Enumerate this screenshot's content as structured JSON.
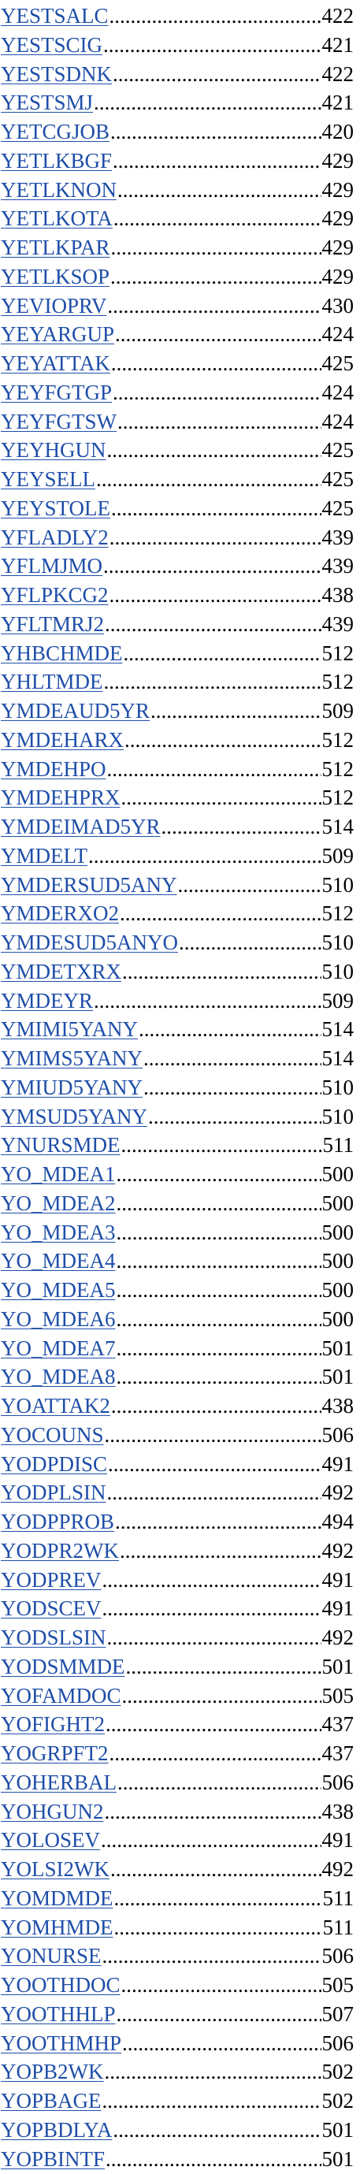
{
  "entries": [
    {
      "name": "YESTSALC",
      "page": "422"
    },
    {
      "name": "YESTSCIG",
      "page": "421"
    },
    {
      "name": "YESTSDNK",
      "page": "422"
    },
    {
      "name": "YESTSMJ",
      "page": "421"
    },
    {
      "name": "YETCGJOB",
      "page": "420"
    },
    {
      "name": "YETLKBGF",
      "page": "429"
    },
    {
      "name": "YETLKNON",
      "page": "429"
    },
    {
      "name": "YETLKOTA",
      "page": "429"
    },
    {
      "name": "YETLKPAR",
      "page": "429"
    },
    {
      "name": "YETLKSOP",
      "page": "429"
    },
    {
      "name": "YEVIOPRV",
      "page": "430"
    },
    {
      "name": "YEYARGUP",
      "page": "424"
    },
    {
      "name": "YEYATTAK",
      "page": "425"
    },
    {
      "name": "YEYFGTGP",
      "page": "424"
    },
    {
      "name": "YEYFGTSW",
      "page": "424"
    },
    {
      "name": "YEYHGUN",
      "page": "425"
    },
    {
      "name": "YEYSELL",
      "page": "425"
    },
    {
      "name": "YEYSTOLE",
      "page": "425"
    },
    {
      "name": "YFLADLY2",
      "page": "439"
    },
    {
      "name": "YFLMJMO",
      "page": "439"
    },
    {
      "name": "YFLPKCG2",
      "page": "438"
    },
    {
      "name": "YFLTMRJ2",
      "page": "439"
    },
    {
      "name": "YHBCHMDE",
      "page": "512"
    },
    {
      "name": "YHLTMDE",
      "page": "512"
    },
    {
      "name": "YMDEAUD5YR",
      "page": "509"
    },
    {
      "name": "YMDEHARX",
      "page": "512"
    },
    {
      "name": "YMDEHPO",
      "page": "512"
    },
    {
      "name": "YMDEHPRX",
      "page": "512"
    },
    {
      "name": "YMDEIMAD5YR",
      "page": "514"
    },
    {
      "name": "YMDELT",
      "page": "509"
    },
    {
      "name": "YMDERSUD5ANY",
      "page": "510"
    },
    {
      "name": "YMDERXO2",
      "page": "512"
    },
    {
      "name": "YMDESUD5ANYO",
      "page": "510"
    },
    {
      "name": "YMDETXRX",
      "page": "510"
    },
    {
      "name": "YMDEYR",
      "page": "509"
    },
    {
      "name": "YMIMI5YANY",
      "page": "514"
    },
    {
      "name": "YMIMS5YANY",
      "page": "514"
    },
    {
      "name": "YMIUD5YANY",
      "page": "510"
    },
    {
      "name": "YMSUD5YANY",
      "page": "510"
    },
    {
      "name": "YNURSMDE",
      "page": "511"
    },
    {
      "name": "YO_MDEA1",
      "page": "500"
    },
    {
      "name": "YO_MDEA2",
      "page": "500"
    },
    {
      "name": "YO_MDEA3",
      "page": "500"
    },
    {
      "name": "YO_MDEA4",
      "page": "500"
    },
    {
      "name": "YO_MDEA5",
      "page": "500"
    },
    {
      "name": "YO_MDEA6",
      "page": "500"
    },
    {
      "name": "YO_MDEA7",
      "page": "501"
    },
    {
      "name": "YO_MDEA8",
      "page": "501"
    },
    {
      "name": "YOATTAK2",
      "page": "438"
    },
    {
      "name": "YOCOUNS",
      "page": "506"
    },
    {
      "name": "YODPDISC",
      "page": "491"
    },
    {
      "name": "YODPLSIN",
      "page": "492"
    },
    {
      "name": "YODPPROB",
      "page": "494"
    },
    {
      "name": "YODPR2WK",
      "page": "492"
    },
    {
      "name": "YODPREV",
      "page": "491"
    },
    {
      "name": "YODSCEV",
      "page": "491"
    },
    {
      "name": "YODSLSIN",
      "page": "492"
    },
    {
      "name": "YODSMMDE",
      "page": "501"
    },
    {
      "name": "YOFAMDOC",
      "page": "505"
    },
    {
      "name": "YOFIGHT2",
      "page": "437"
    },
    {
      "name": "YOGRPFT2",
      "page": "437"
    },
    {
      "name": "YOHERBAL",
      "page": "506"
    },
    {
      "name": "YOHGUN2",
      "page": "438"
    },
    {
      "name": "YOLOSEV",
      "page": "491"
    },
    {
      "name": "YOLSI2WK",
      "page": "492"
    },
    {
      "name": "YOMDMDE",
      "page": "511"
    },
    {
      "name": "YOMHMDE",
      "page": "511"
    },
    {
      "name": "YONURSE",
      "page": "506"
    },
    {
      "name": "YOOTHDOC",
      "page": "505"
    },
    {
      "name": "YOOTHHLP",
      "page": "507"
    },
    {
      "name": "YOOTHMHP",
      "page": "506"
    },
    {
      "name": "YOPB2WK",
      "page": "502"
    },
    {
      "name": "YOPBAGE",
      "page": "502"
    },
    {
      "name": "YOPBDLYA",
      "page": "501"
    },
    {
      "name": "YOPBINTF",
      "page": "501"
    }
  ]
}
